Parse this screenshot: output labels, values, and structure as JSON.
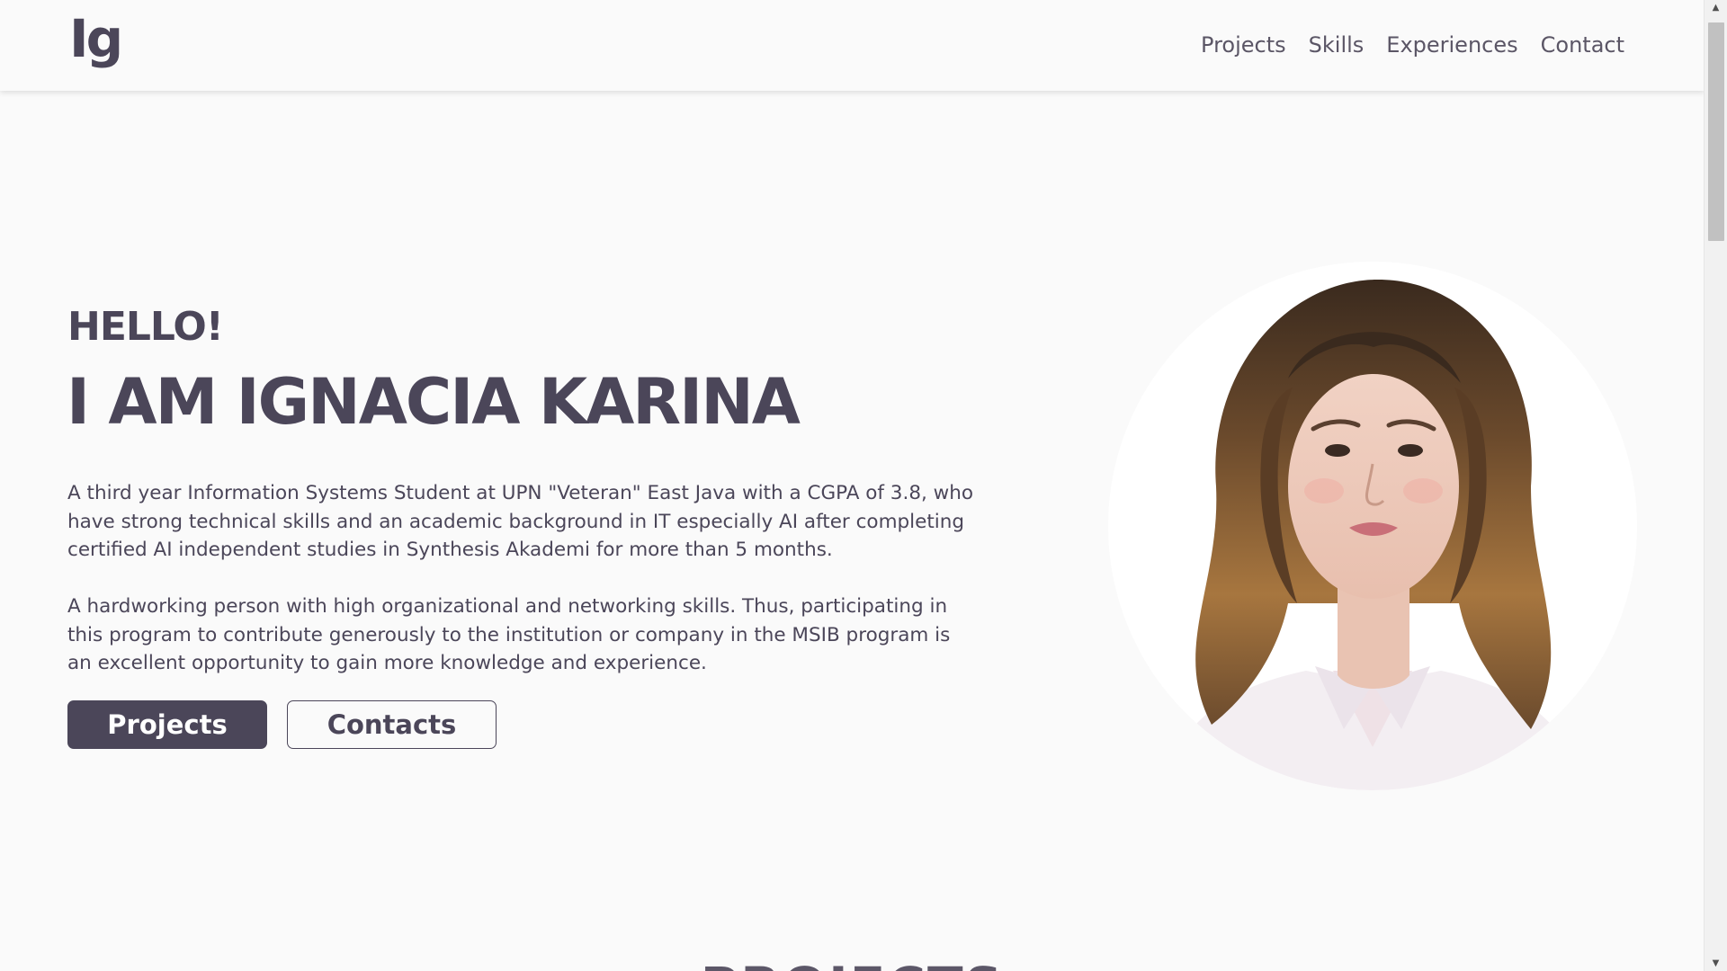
{
  "navbar": {
    "logo": "Ig",
    "links": [
      "Projects",
      "Skills",
      "Experiences",
      "Contact"
    ]
  },
  "hero": {
    "greeting": "HELLO!",
    "name": "I AM IGNACIA KARINA",
    "paragraph1": "A third year Information Systems Student at UPN \"Veteran\" East Java with a CGPA of 3.8, who have strong technical skills and an academic background in IT especially AI after completing certified AI independent studies in Synthesis Akademi for more than 5 months.",
    "paragraph2": "A hardworking person with high organizational and networking skills. Thus, participating in this program to contribute generously to the institution or company in the MSIB program is an excellent opportunity to gain more knowledge and experience.",
    "buttons": {
      "projects": "Projects",
      "contacts": "Contacts"
    }
  },
  "next_section": {
    "title": "PROJECTS"
  },
  "colors": {
    "primary": "#4b4659",
    "background": "#fafafa",
    "button_text": "#ffffff"
  },
  "icons": {
    "scroll_up": "triangle-up-icon",
    "scroll_down": "triangle-down-icon"
  }
}
